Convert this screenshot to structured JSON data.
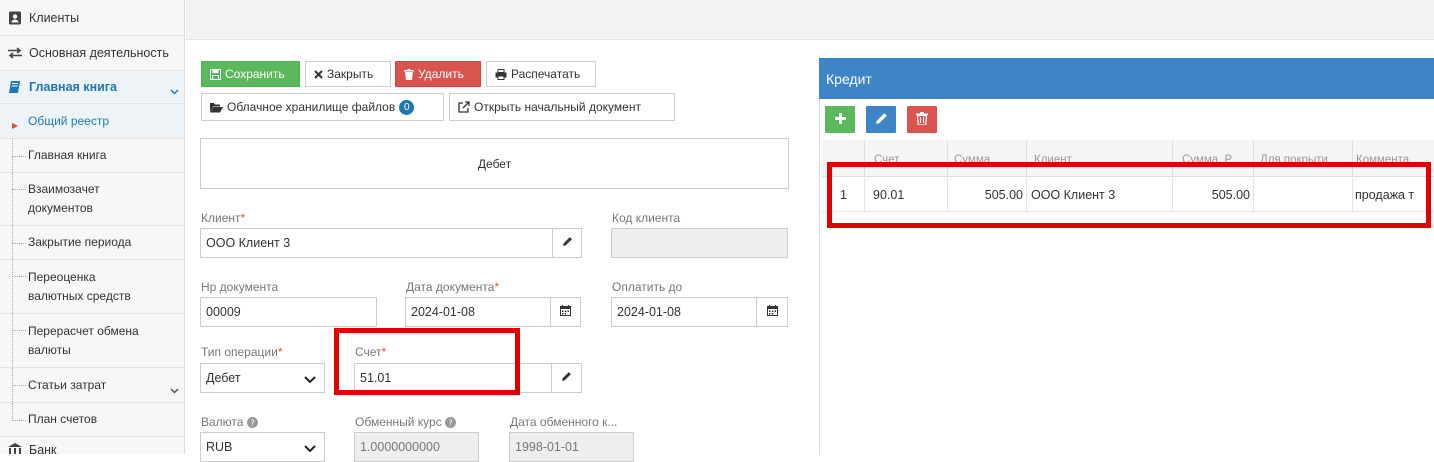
{
  "sidebar": {
    "clients": "Клиенты",
    "main_activity": "Основная деятельность",
    "general_ledger_group": "Главная книга",
    "sub_items": [
      "Общий реестр",
      "Главная книга",
      "Взаимозачет документов",
      "Закрытие периода",
      "Переоценка валютных средств",
      "Перерасчет обмена валюты",
      "Статьи затрат",
      "План счетов"
    ],
    "bank": "Банк"
  },
  "toolbar": {
    "save": "Сохранить",
    "close": "Закрыть",
    "delete": "Удалить",
    "print": "Распечатать",
    "cloud_storage": "Облачное хранилище файлов",
    "cloud_badge": "0",
    "open_initial": "Открыть начальный документ"
  },
  "form": {
    "section_title": "Дебет",
    "client_label": "Клиент",
    "client_value": "ООО Клиент 3",
    "client_code_label": "Код клиента",
    "client_code_value": "",
    "doc_no_label": "Нр документа",
    "doc_no_value": "00009",
    "doc_date_label": "Дата документа",
    "doc_date_value": "2024-01-08",
    "pay_until_label": "Оплатить до",
    "pay_until_value": "2024-01-08",
    "op_type_label": "Тип операции",
    "op_type_value": "Дебет",
    "account_label": "Счет",
    "account_value": "51.01",
    "currency_label": "Валюта",
    "currency_value": "RUB",
    "rate_label": "Обменный курс",
    "rate_value": "1.0000000000",
    "rate_date_label": "Дата обменного к...",
    "rate_date_value": "1998-01-01",
    "required_mark": "*"
  },
  "credit": {
    "title": "Кредит",
    "columns": [
      "Счет",
      "Сумма",
      "Клиент",
      "Сумма, Р",
      "Для покрыти",
      "Коммента"
    ],
    "rows": [
      {
        "no": "1",
        "account": "90.01",
        "amount": "505.00",
        "client": "ООО Клиент 3",
        "amount_r": "505.00",
        "cover": "",
        "comment": "продажа т"
      }
    ]
  },
  "colors": {
    "accent": "#3d85c6",
    "success": "#5cb85c",
    "danger": "#d9534f",
    "highlight": "#e00000"
  }
}
